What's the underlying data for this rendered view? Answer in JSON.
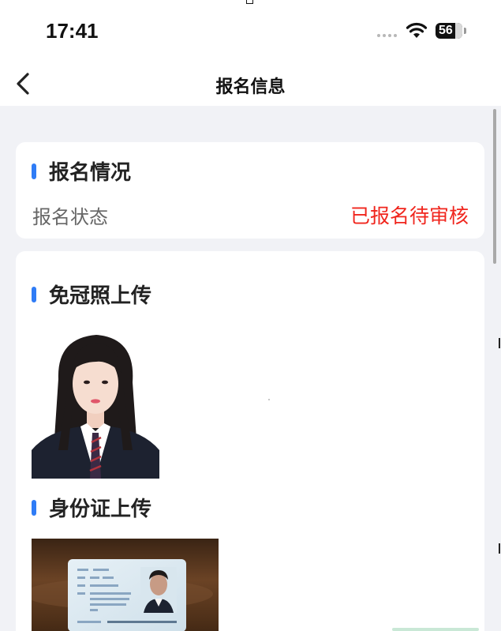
{
  "status_bar": {
    "time": "17:41",
    "battery": "56"
  },
  "nav": {
    "title": "报名信息"
  },
  "registration": {
    "title": "报名情况",
    "status_label": "报名状态",
    "status_value": "已报名待审核",
    "status_color": "#f0261e"
  },
  "uploads": {
    "photo_title": "免冠照上传",
    "id_title": "身份证上传"
  },
  "colors": {
    "accent": "#2f7cf6",
    "background": "#f1f2f6"
  },
  "icons": {
    "back": "chevron-left-icon",
    "wifi": "wifi-icon",
    "battery": "battery-icon"
  }
}
